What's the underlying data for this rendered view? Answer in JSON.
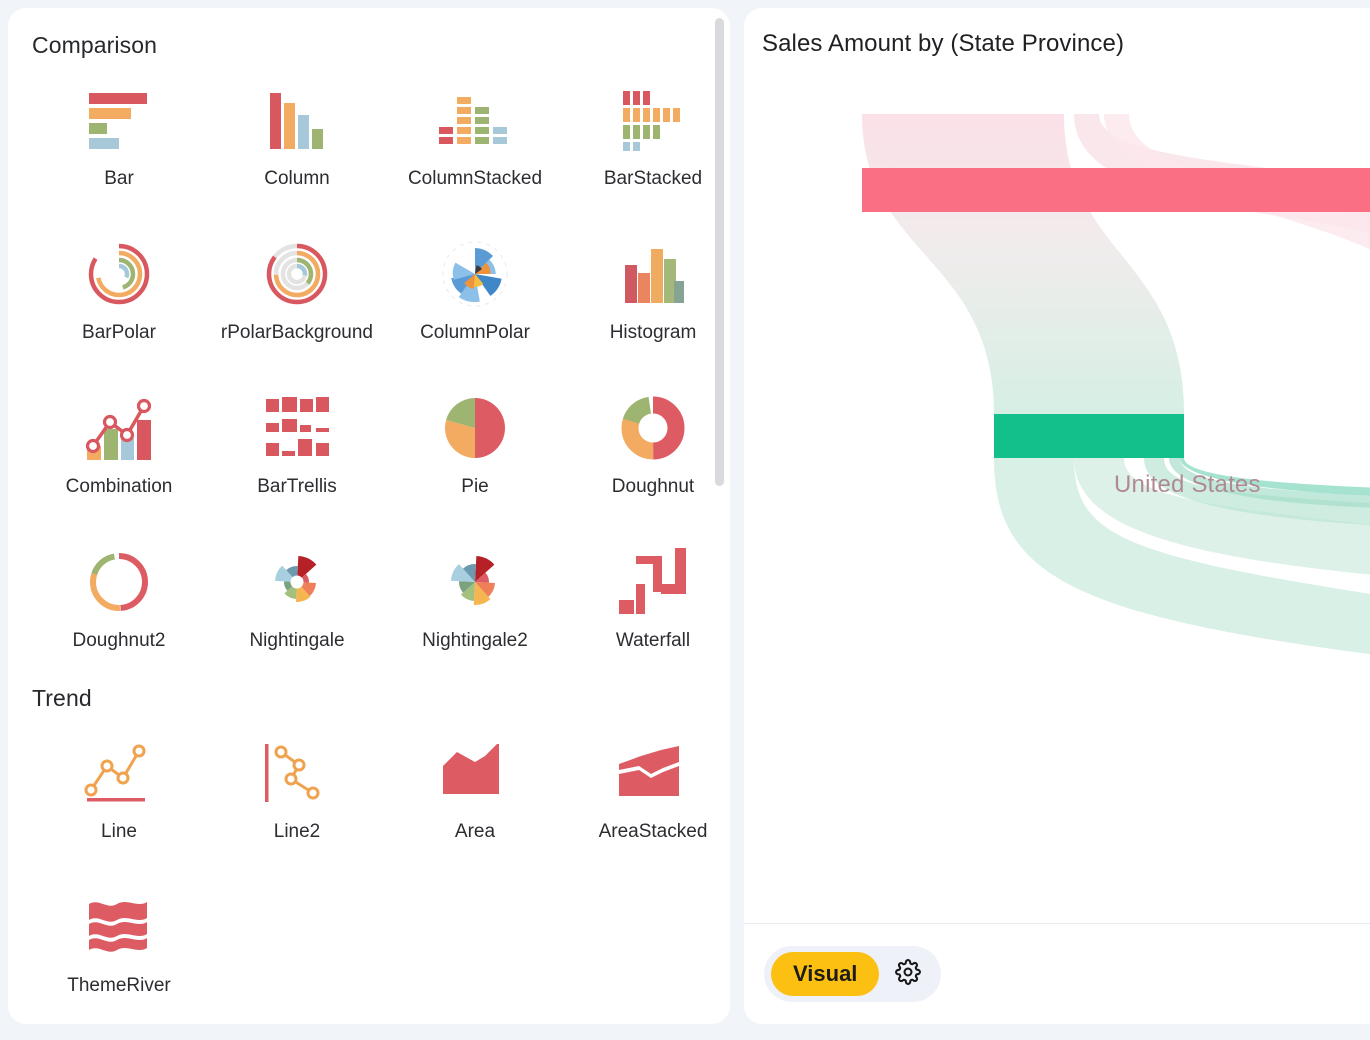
{
  "left_panel": {
    "groups": [
      {
        "title": "Comparison",
        "items": [
          {
            "label": "Bar",
            "icon": "bar-chart-icon"
          },
          {
            "label": "Column",
            "icon": "column-chart-icon"
          },
          {
            "label": "ColumnStacked",
            "icon": "column-stacked-chart-icon",
            "truncate": "right"
          },
          {
            "label": "BarStacked",
            "icon": "bar-stacked-chart-icon"
          },
          {
            "label": "BarPolar",
            "icon": "bar-polar-chart-icon"
          },
          {
            "label": "BarPolarBackground",
            "icon": "bar-polar-background-chart-icon",
            "truncate": "both"
          },
          {
            "label": "ColumnPolar",
            "icon": "column-polar-chart-icon"
          },
          {
            "label": "Histogram",
            "icon": "histogram-chart-icon"
          },
          {
            "label": "Combination",
            "icon": "combination-chart-icon"
          },
          {
            "label": "BarTrellis",
            "icon": "bar-trellis-chart-icon"
          },
          {
            "label": "Pie",
            "icon": "pie-chart-icon"
          },
          {
            "label": "Doughnut",
            "icon": "doughnut-chart-icon"
          },
          {
            "label": "Doughnut2",
            "icon": "doughnut2-chart-icon"
          },
          {
            "label": "Nightingale",
            "icon": "nightingale-chart-icon"
          },
          {
            "label": "Nightingale2",
            "icon": "nightingale2-chart-icon"
          },
          {
            "label": "Waterfall",
            "icon": "waterfall-chart-icon"
          }
        ]
      },
      {
        "title": "Trend",
        "items": [
          {
            "label": "Line",
            "icon": "line-chart-icon"
          },
          {
            "label": "Line2",
            "icon": "line2-chart-icon"
          },
          {
            "label": "Area",
            "icon": "area-chart-icon"
          },
          {
            "label": "AreaStacked",
            "icon": "area-stacked-chart-icon"
          },
          {
            "label": "ThemeRiver",
            "icon": "theme-river-chart-icon"
          }
        ]
      }
    ],
    "scrollbar": {
      "name": "vertical-scrollbar"
    }
  },
  "right_panel": {
    "title": "Sales Amount by (State Province)",
    "toolbar": {
      "visual_label": "Visual",
      "settings_icon": "gear-icon"
    }
  },
  "chart_data": {
    "type": "sankey",
    "title": "Sales Amount by (State Province)",
    "nodes": [
      {
        "name": "Sales Amount",
        "color": "#fb6f84",
        "label": ""
      },
      {
        "name": "United States",
        "color": "#13c08b",
        "label": "United States"
      }
    ],
    "node_label_color": "#b08a93",
    "link_colors": {
      "from": "#fbe4e9",
      "to": "#d9f0e6"
    },
    "links": [
      {
        "source": "Sales Amount",
        "target": "United States",
        "value": 100
      }
    ]
  },
  "colors": {
    "page_background": "#f1f4f9",
    "panel_background": "#ffffff",
    "accent_yellow": "#fcc013",
    "sankey_pink": "#fb6f84",
    "sankey_green": "#13c08b",
    "scrollbar_thumb": "#d8dadd"
  }
}
